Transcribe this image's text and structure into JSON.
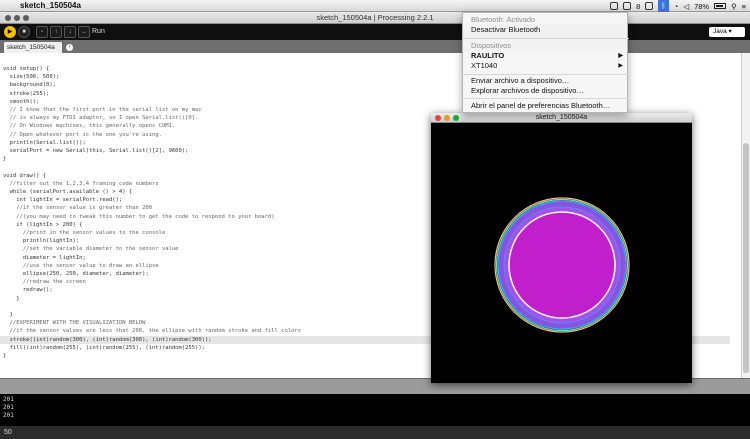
{
  "menubar": {
    "app_title": "sketch_150504a",
    "battery": "78%",
    "badge": "8"
  },
  "processing_window": {
    "title": "sketch_150504a | Processing 2.2.1",
    "run_label": "Run",
    "mode": "Java ▾",
    "tab": "sketch_150504a",
    "status_line": "50"
  },
  "code_lines": [
    "void setup() {",
    "  size(500, 500);",
    "  background(0);",
    "  stroke(255);",
    "  smooth();",
    "  // I know that the first port in the serial list on my mac",
    "  // is always my FTDI adaptor, so I open Serial.list()[0].",
    "  // On Windows machines, this generally opens COM1.",
    "  // Open whatever port is the one you're using.",
    "  println(Serial.list());",
    "  serialPort = new Serial(this, Serial.list()[2], 9600);",
    "}",
    "",
    "void draw() {",
    "  //filter out the 1,2,3,4 framing code numbers",
    "  while (serialPort.available () > 4) {",
    "    int lightIn = serialPort.read();",
    "    //if the sensor value is greater than 200",
    "    //(you may need to tweak this number to get the code to respond to your board)",
    "    if (lightIn > 200) {",
    "      //print in the sensor values to the console",
    "      println(lightIn);",
    "      //set the variable diameter to the sensor value",
    "      diameter = lightIn;",
    "      //use the sensor value to draw an ellipse",
    "      ellipse(250, 250, diameter, diameter);",
    "      //redraw the screen",
    "      redraw();",
    "    }",
    "",
    "  }",
    "  //EXPERIMENT WITH THE VISUALIZATION BELOW",
    "  //if the sensor values are less that 200, the ellipse with random stroke and fill colors",
    "  stroke((int)random(300), (int)random(300), (int)random(300));",
    "  fill((int)random(255), (int)random(255), (int)random(255));",
    "}"
  ],
  "console_lines": [
    "201",
    "201",
    "201"
  ],
  "sketch_window": {
    "title": "sketch_150504a"
  },
  "bluetooth_menu": {
    "status": "Bluetooth: Activado",
    "toggle": "Desactivar Bluetooth",
    "devices_header": "Dispositivos",
    "device_1": "RAULITO",
    "device_2": "XT1040",
    "send_file": "Enviar archivo a dispositivo…",
    "browse_files": "Explorar archivos de dispositivo…",
    "open_prefs": "Abrir el panel de preferencias Bluetooth…"
  }
}
